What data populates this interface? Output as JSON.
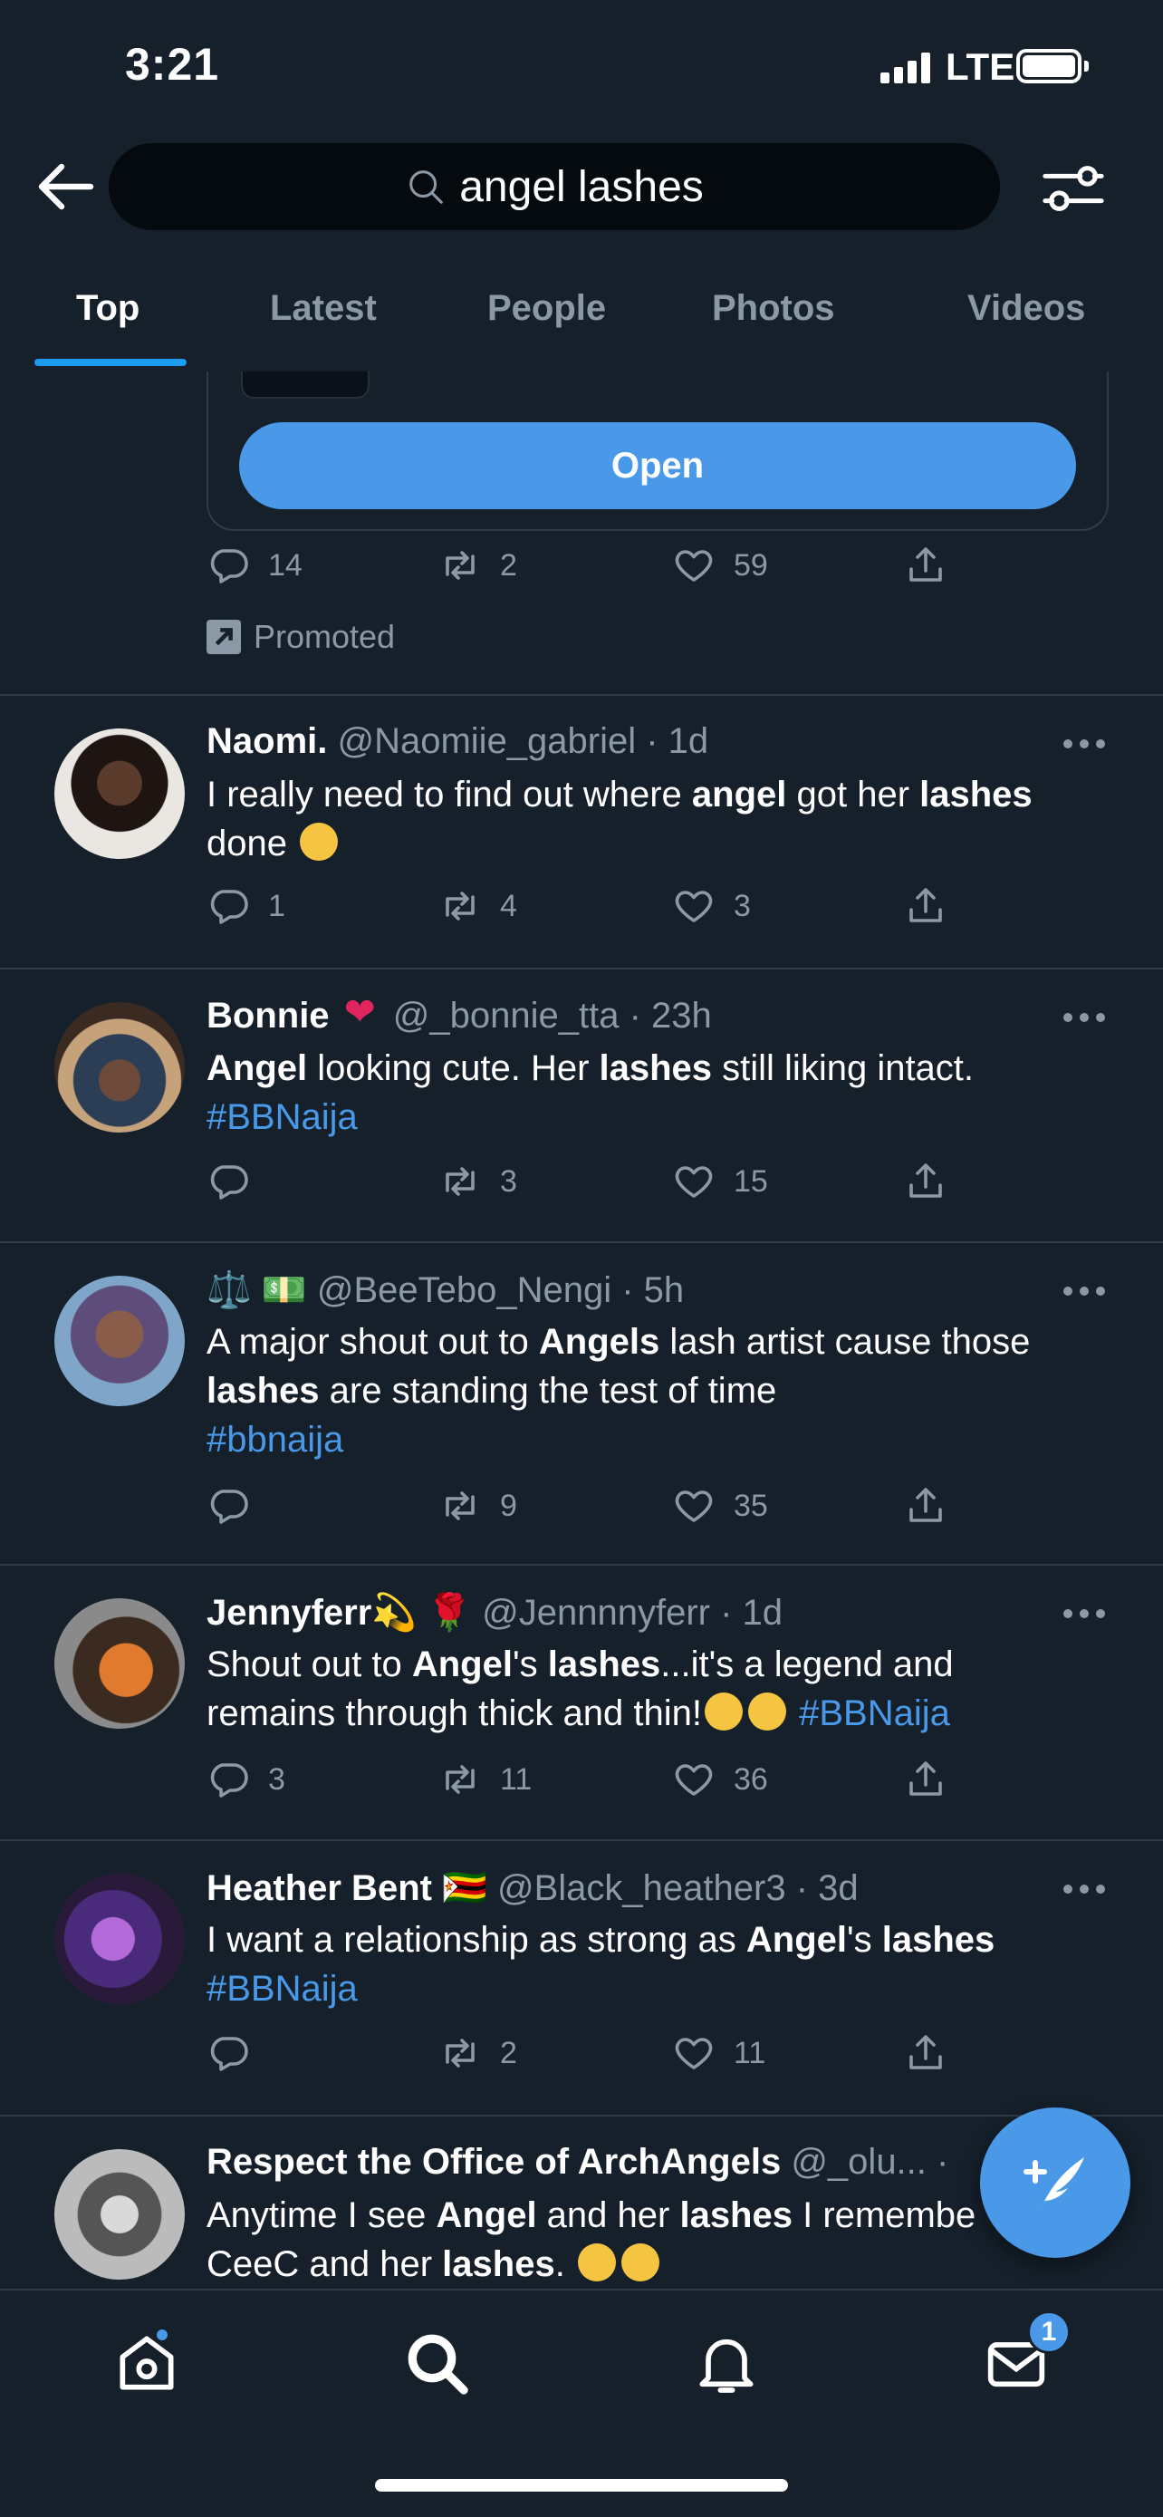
{
  "status_bar": {
    "time": "3:21",
    "network": "LTE"
  },
  "search": {
    "query": "angel lashes"
  },
  "tabs": [
    {
      "label": "Top",
      "active": true
    },
    {
      "label": "Latest",
      "active": false
    },
    {
      "label": "People",
      "active": false
    },
    {
      "label": "Photos",
      "active": false
    },
    {
      "label": "Videos",
      "active": false
    }
  ],
  "promo": {
    "button_label": "Open",
    "replies": "14",
    "retweets": "2",
    "likes": "59",
    "promoted_label": "Promoted"
  },
  "tweets": [
    {
      "name": "Naomi.",
      "handle_time": "@Naomiie_gabriel · 1d",
      "replies": "1",
      "retweets": "4",
      "likes": "3"
    },
    {
      "name": "Bonnie",
      "handle_time": "@_bonnie_tta · 23h",
      "hashtag": "#BBNaija",
      "replies": "",
      "retweets": "3",
      "likes": "15"
    },
    {
      "name": "⚖️ 💵",
      "handle_time": "@BeeTebo_Nengi · 5h",
      "hashtag": "#bbnaija",
      "replies": "",
      "retweets": "9",
      "likes": "35"
    },
    {
      "name": "Jennyferr💫 🌹",
      "handle_time": "@Jennnnyferr · 1d",
      "hashtag": "#BBNaija",
      "replies": "3",
      "retweets": "11",
      "likes": "36"
    },
    {
      "name": "Heather Bent 🇿🇼",
      "handle_time": "@Black_heather3 · 3d",
      "hashtag": "#BBNaija",
      "replies": "",
      "retweets": "2",
      "likes": "11"
    },
    {
      "name": "Respect the Office of ArchAngels",
      "handle_time": "@_olu... ·"
    }
  ],
  "texts": {
    "t0": [
      "I really need to find out where ",
      "angel",
      " got her ",
      "lashes",
      " done"
    ],
    "t1": [
      "Angel",
      " looking cute. Her ",
      "lashes",
      " still liking intact."
    ],
    "t2a": [
      "A major shout out to ",
      "Angels",
      " lash artist cause those"
    ],
    "t2b": [
      "lashes",
      " are standing the test of time"
    ],
    "t3a": [
      "Shout out to ",
      "Angel",
      "'s ",
      "lashes",
      "...it's a legend and"
    ],
    "t3b": "remains through thick and thin!",
    "t4": [
      "I want a relationship as strong as ",
      "Angel",
      "'s ",
      "lashes"
    ],
    "t5a": [
      "Anytime I see ",
      "Angel",
      " and her ",
      "lashes",
      " I remembe"
    ],
    "t5b": [
      "CeeC and her ",
      "lashes",
      "."
    ]
  },
  "nav": {
    "messages_badge": "1"
  },
  "icons": [
    "back-arrow-icon",
    "search-icon",
    "filter-icon",
    "reply-icon",
    "retweet-icon",
    "like-icon",
    "share-icon",
    "more-icon",
    "compose-icon",
    "home-icon",
    "explore-icon",
    "notifications-icon",
    "messages-icon"
  ],
  "colors": {
    "background": "#15202b",
    "accent": "#1d9bf0",
    "button": "#4a99e9",
    "muted": "#8b98a5",
    "divider": "#2f3b47"
  }
}
